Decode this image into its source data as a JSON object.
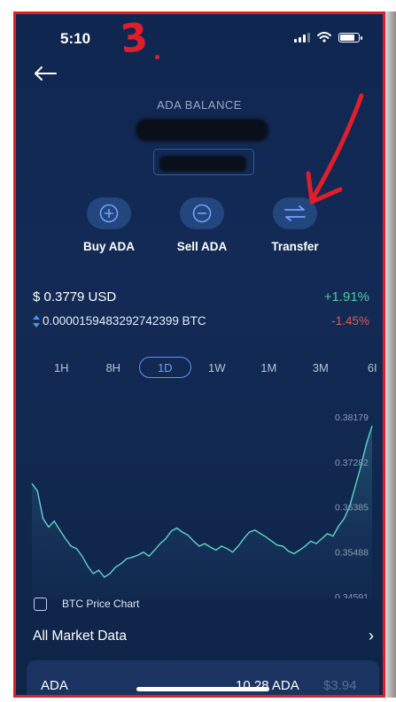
{
  "status_bar": {
    "time": "5:10",
    "annotation_number": "3"
  },
  "colors": {
    "background": "#122a55",
    "accent": "#5d93ff",
    "positive": "#4fcf9a",
    "negative": "#e05a5a",
    "annotation": "#e01e2a"
  },
  "header": {
    "back_icon": "arrow-left-icon",
    "title": "ADA BALANCE"
  },
  "actions": [
    {
      "label": "Buy ADA",
      "icon": "plus-circle-icon"
    },
    {
      "label": "Sell ADA",
      "icon": "minus-circle-icon"
    },
    {
      "label": "Transfer",
      "icon": "transfer-arrows-icon"
    }
  ],
  "prices": {
    "usd": "$ 0.3779 USD",
    "usd_change": "+1.91%",
    "btc": "0.0000159483292742399 BTC",
    "btc_change": "-1.45%"
  },
  "ranges": [
    "1H",
    "8H",
    "1D",
    "1W",
    "1M",
    "3M",
    "6I"
  ],
  "selected_range": "1D",
  "chart_data": {
    "type": "area",
    "y_ticks": [
      "0.38179",
      "0.37282",
      "0.36385",
      "0.35488",
      "0.34591"
    ],
    "ylim": [
      0.34591,
      0.38179
    ],
    "values": [
      0.3685,
      0.367,
      0.3615,
      0.3598,
      0.361,
      0.3592,
      0.3575,
      0.356,
      0.3555,
      0.354,
      0.352,
      0.3505,
      0.3512,
      0.3498,
      0.3505,
      0.3518,
      0.3525,
      0.3535,
      0.3538,
      0.3542,
      0.3548,
      0.354,
      0.3552,
      0.3565,
      0.3575,
      0.359,
      0.3596,
      0.3588,
      0.3582,
      0.357,
      0.356,
      0.3565,
      0.3558,
      0.3552,
      0.356,
      0.3555,
      0.3548,
      0.356,
      0.3575,
      0.3588,
      0.3592,
      0.3585,
      0.3578,
      0.357,
      0.3562,
      0.356,
      0.355,
      0.3545,
      0.3552,
      0.356,
      0.357,
      0.3565,
      0.3575,
      0.3585,
      0.358,
      0.36,
      0.3615,
      0.364,
      0.368,
      0.372,
      0.3765,
      0.38
    ]
  },
  "btc_chart": {
    "label": "BTC Price Chart",
    "checked": false
  },
  "market": {
    "label": "All Market Data"
  },
  "holding": {
    "name": "ADA",
    "amount": "10.28 ADA",
    "value": "$3.94"
  }
}
